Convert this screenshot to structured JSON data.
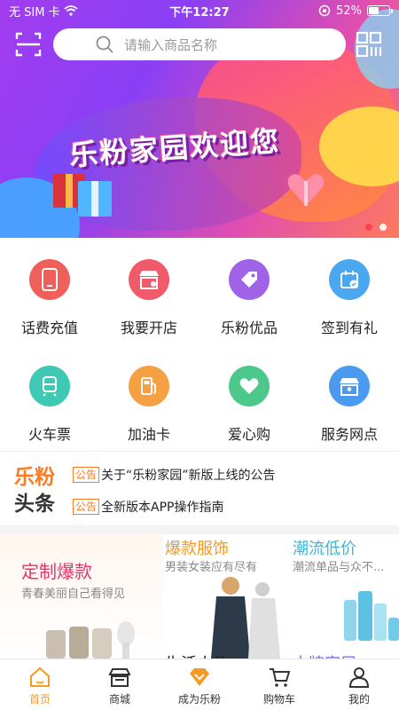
{
  "status_bar": {
    "carrier": "无 SIM 卡",
    "time": "下午12:27",
    "battery": "52%",
    "battery_level": 0.52
  },
  "search": {
    "placeholder": "请输入商品名称"
  },
  "banner": {
    "title": "乐粉家园欢迎您",
    "dot_count": 2,
    "active_dot": 0
  },
  "grid": {
    "items": [
      {
        "label": "话费充值",
        "icon": "phone-icon",
        "color": "#f0605a"
      },
      {
        "label": "我要开店",
        "icon": "shop-icon",
        "color": "#f05a6a"
      },
      {
        "label": "乐粉优品",
        "icon": "tag-icon",
        "color": "#a063e8"
      },
      {
        "label": "签到有礼",
        "icon": "calendar-check-icon",
        "color": "#4aa8f0"
      },
      {
        "label": "火车票",
        "icon": "train-icon",
        "color": "#3fc9b5"
      },
      {
        "label": "加油卡",
        "icon": "fuel-icon",
        "color": "#f5a043"
      },
      {
        "label": "爱心购",
        "icon": "heart-icon",
        "color": "#4cc98a"
      },
      {
        "label": "服务网点",
        "icon": "store-location-icon",
        "color": "#4a9bf0"
      }
    ]
  },
  "headlines": {
    "brand_line1": "乐粉",
    "brand_line2": "头条",
    "items": [
      {
        "tag": "公告",
        "text": "关于“乐粉家园”新版上线的公告"
      },
      {
        "tag": "公告",
        "text": "全新版本APP操作指南"
      }
    ]
  },
  "promo": {
    "custom": {
      "title": "定制爆款",
      "subtitle": "青春美丽自己看得见"
    },
    "clothing": {
      "title": "爆款服饰",
      "subtitle": "男装女装应有尽有"
    },
    "trend": {
      "title": "潮流低价",
      "subtitle": "潮流单品与众不..."
    },
    "life": {
      "title": "生活小件"
    },
    "appliances": {
      "title": "大牌家居"
    }
  },
  "tabbar": {
    "items": [
      {
        "label": "首页",
        "icon": "home-icon",
        "active": true
      },
      {
        "label": "商城",
        "icon": "store-icon",
        "active": false
      },
      {
        "label": "成为乐粉",
        "icon": "diamond-icon",
        "active": false
      },
      {
        "label": "购物车",
        "icon": "cart-icon",
        "active": false
      },
      {
        "label": "我的",
        "icon": "user-icon",
        "active": false
      }
    ]
  },
  "colors": {
    "accent": "#f59a25",
    "brand_orange": "#ff7a20",
    "promo_pink": "#e8336b",
    "promo_cyan": "#3bb8d9",
    "promo_purple": "#7c62e6"
  }
}
